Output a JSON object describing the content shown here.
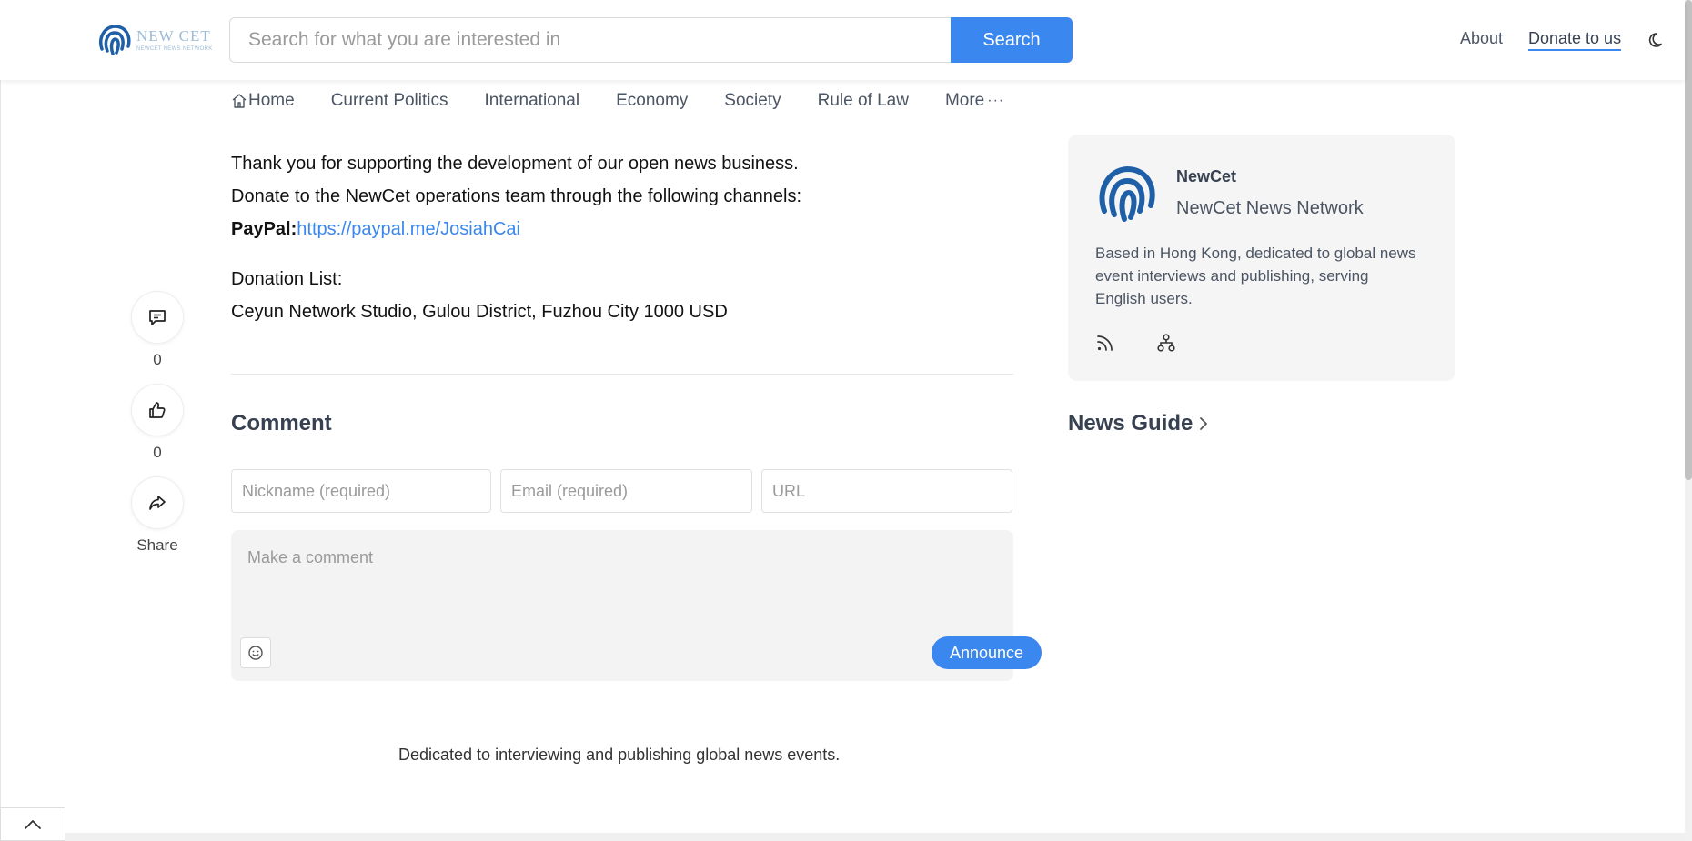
{
  "header": {
    "logo_text": "NEW CET",
    "logo_subtext": "NEWCET NEWS NETWORK",
    "search_placeholder": "Search for what you are interested in",
    "search_button": "Search",
    "about": "About",
    "donate": "Donate to us"
  },
  "nav": {
    "items": [
      "Home",
      "Current Politics",
      "International",
      "Economy",
      "Society",
      "Rule of Law",
      "More"
    ]
  },
  "article": {
    "line1": "Thank you for supporting the development of our open news business.",
    "line2": "Donate to the NewCet operations team through the following channels:",
    "paypal_label": "PayPal:",
    "paypal_link": "https://paypal.me/JosiahCai",
    "list_title": "Donation List:",
    "list_entry": "Ceyun Network Studio, Gulou District, Fuzhou City 1000 USD"
  },
  "actions": {
    "comments_count": "0",
    "likes_count": "0",
    "share_label": "Share"
  },
  "comment": {
    "title": "Comment",
    "nickname_placeholder": "Nickname (required)",
    "email_placeholder": "Email (required)",
    "url_placeholder": "URL",
    "textarea_placeholder": "Make a comment",
    "submit_label": "Announce"
  },
  "sidebar": {
    "name": "NewCet",
    "subtitle": "NewCet News Network",
    "description": "Based in Hong Kong, dedicated to global news event interviews and publishing, serving English users.",
    "guide_title": "News Guide"
  },
  "footer": {
    "text": "Dedicated to interviewing and publishing global news events."
  },
  "colors": {
    "accent": "#3b87f0",
    "logo_blue": "#1e5fa8",
    "card_bg": "#f5f5f5"
  }
}
